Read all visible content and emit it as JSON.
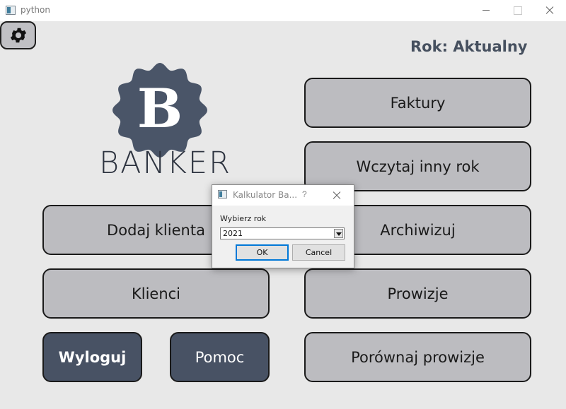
{
  "window": {
    "title": "python"
  },
  "header": {
    "year_label": "Rok: Aktualny"
  },
  "logo": {
    "letter": "B",
    "text": "BANKER",
    "badge_color": "#4a5568"
  },
  "icons": {
    "settings": "gear-icon",
    "app": "window-app-icon"
  },
  "buttons": {
    "faktury": "Faktury",
    "wczytaj": "Wczytaj inny rok",
    "dodaj_klienta": "Dodaj klienta",
    "archiwizuj": "Archiwizuj",
    "klienci": "Klienci",
    "prowizje": "Prowizje",
    "wyloguj": "Wyloguj",
    "pomoc": "Pomoc",
    "porownaj": "Porównaj prowizje"
  },
  "colors": {
    "button_light": "#bcbcc0",
    "button_dark": "#485264",
    "accent_text": "#46505f"
  },
  "dialog": {
    "title": "Kalkulator Ba...",
    "help": "?",
    "label": "Wybierz rok",
    "select_value": "2021",
    "ok": "OK",
    "cancel": "Cancel"
  }
}
